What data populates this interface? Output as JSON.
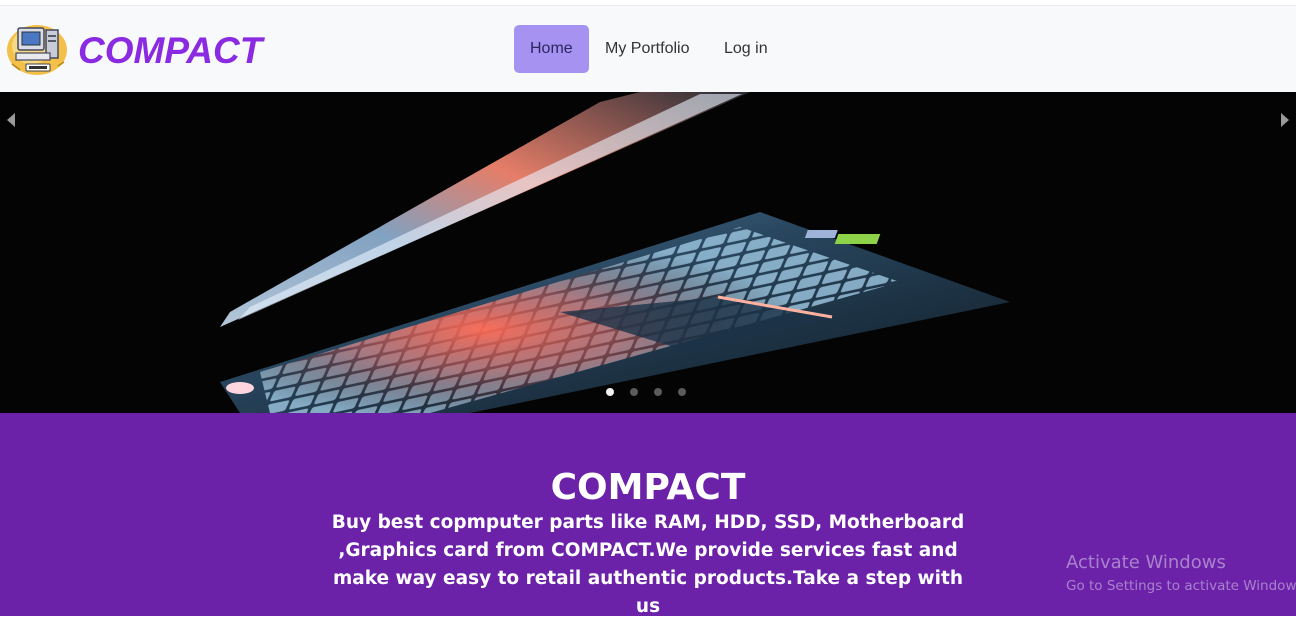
{
  "brand": {
    "name": "COMPACT",
    "logo": "computer-logo-icon"
  },
  "nav": {
    "items": [
      {
        "label": "Home",
        "active": true
      },
      {
        "label": "My Portfolio",
        "active": false
      },
      {
        "label": "Log in",
        "active": false
      }
    ]
  },
  "carousel": {
    "slide_image": "laptop-keyboard-photo",
    "indicator_count": 4,
    "active_index": 0,
    "prev_icon": "caret-left-icon",
    "next_icon": "caret-right-icon"
  },
  "hero": {
    "title": "COMPACT",
    "text": "Buy best copmputer parts like RAM, HDD, SSD, Motherboard ,Graphics card from COMPACT.We provide services fast and make way easy to retail authentic products.Take a step with us"
  },
  "watermark": {
    "title": "Activate Windows",
    "subtitle": "Go to Settings to activate Windows."
  },
  "colors": {
    "brand": "#8a2be2",
    "nav_active_bg": "#a592f1",
    "hero_bg": "#6b21a8",
    "navbar_bg": "#f8f9fb"
  }
}
